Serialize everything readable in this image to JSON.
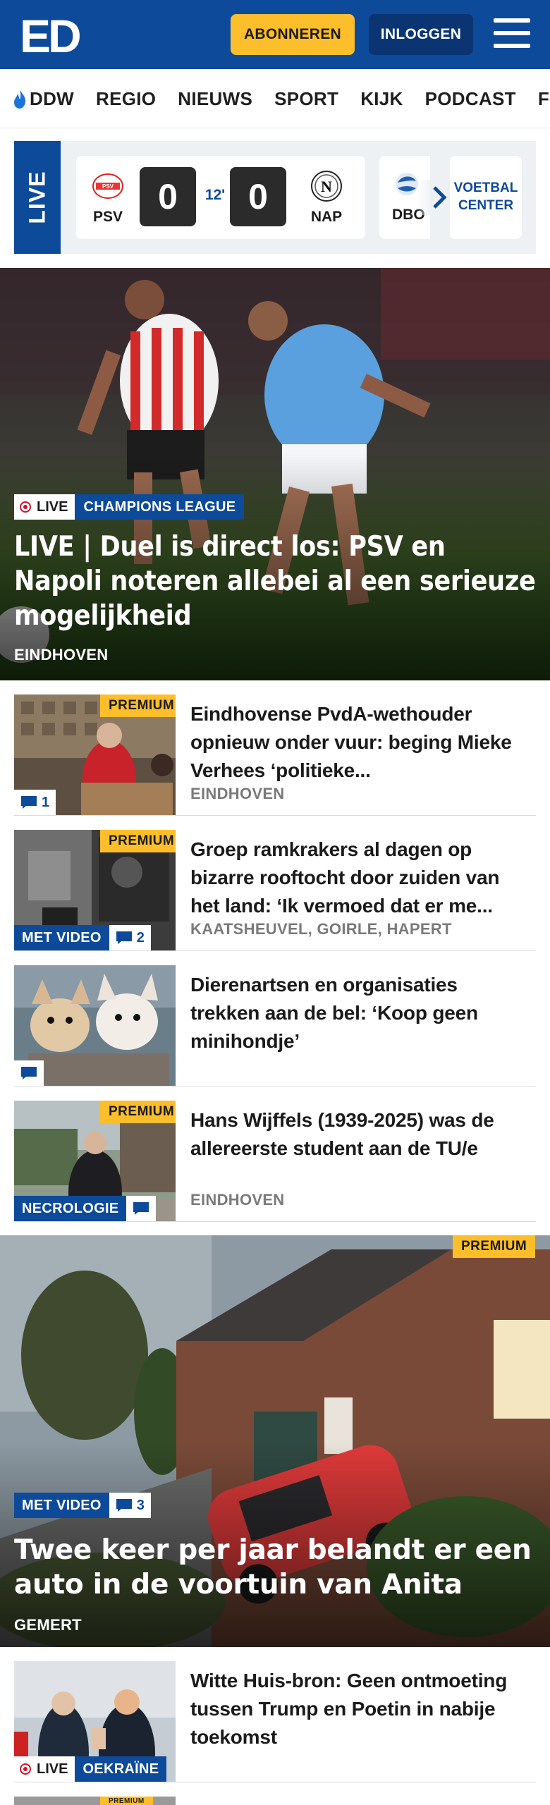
{
  "header": {
    "logo_text": "ED",
    "subscribe_label": "ABONNEREN",
    "login_label": "INLOGGEN"
  },
  "nav": {
    "items": [
      {
        "label": "DDW"
      },
      {
        "label": "REGIO"
      },
      {
        "label": "NIEUWS"
      },
      {
        "label": "SPORT"
      },
      {
        "label": "KIJK"
      },
      {
        "label": "PODCAST"
      },
      {
        "label": "FEE"
      }
    ]
  },
  "live_strip": {
    "label": "LIVE",
    "match": {
      "home_team": "PSV",
      "home_score": "0",
      "minute": "12'",
      "away_score": "0",
      "away_team": "NAP"
    },
    "next_team": "DBO",
    "center_label": "VOETBAL CENTER"
  },
  "hero": {
    "live_label": "LIVE",
    "category": "CHAMPIONS LEAGUE",
    "title": "LIVE | Duel is direct los: PSV en Napoli noteren allebei al een serieuze mogelijkheid",
    "location": "EINDHOVEN"
  },
  "articles": [
    {
      "premium": "PREMIUM",
      "title": "Eindhovense PvdA-wethouder opnieuw onder vuur: beging Mieke Verhees ‘politieke...",
      "location": "EINDHOVEN",
      "comments": "1"
    },
    {
      "premium": "PREMIUM",
      "title": "Groep ramkrakers al dagen op bizarre rooftocht door zuiden van het land: ‘Ik vermoed dat er me...",
      "location": "KAATSHEUVEL, GOIRLE, HAPERT",
      "video_label": "MET VIDEO",
      "comments": "2"
    },
    {
      "title": "Dierenartsen en organisaties trekken aan de bel: ‘Koop geen minihondje’"
    },
    {
      "premium": "PREMIUM",
      "title": "Hans Wijffels (1939-2025) was de allereerste student aan de TU/e",
      "location": "EINDHOVEN",
      "tag_label": "NECROLOGIE"
    }
  ],
  "feature": {
    "premium": "PREMIUM",
    "video_label": "MET VIDEO",
    "comments": "3",
    "title": "Twee keer per jaar belandt er een auto in de voortuin van Anita",
    "location": "GEMERT"
  },
  "bottom_article": {
    "title": "Witte Huis-bron: Geen ontmoeting tussen Trump en Poetin in nabije toekomst",
    "live_label": "LIVE",
    "category": "OEKRAÏNE",
    "next_premium": "PREMIUM"
  },
  "colors": {
    "brand_blue": "#0d4a9a",
    "accent_yellow": "#fcbe2a",
    "live_red": "#d4102c"
  }
}
